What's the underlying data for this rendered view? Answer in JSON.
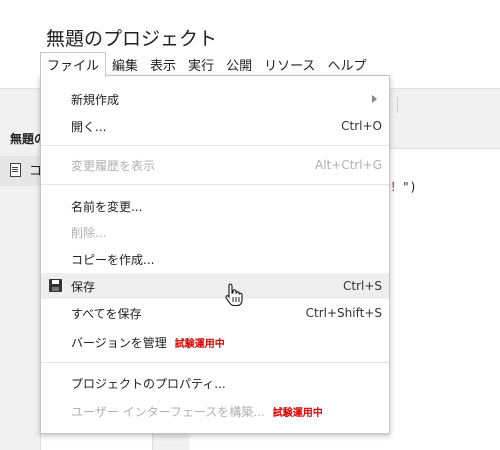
{
  "window": {
    "title": "無題のプロジェクト"
  },
  "menubar": {
    "items": [
      "ファイル",
      "編集",
      "表示",
      "実行",
      "公開",
      "リソース",
      "ヘルプ"
    ]
  },
  "sidebar": {
    "title": "無題の",
    "file": "コ"
  },
  "editor": {
    "fragment_text": "d！",
    "fragment_close": "\")"
  },
  "file_menu": {
    "new": {
      "label": "新規作成"
    },
    "open": {
      "label": "開く...",
      "shortcut": "Ctrl+O"
    },
    "history": {
      "label": "変更履歴を表示",
      "shortcut": "Alt+Ctrl+G"
    },
    "rename": {
      "label": "名前を変更..."
    },
    "delete": {
      "label": "削除..."
    },
    "copy": {
      "label": "コピーを作成..."
    },
    "save": {
      "label": "保存",
      "shortcut": "Ctrl+S"
    },
    "save_all": {
      "label": "すべてを保存",
      "shortcut": "Ctrl+Shift+S"
    },
    "versions": {
      "label": "バージョンを管理",
      "badge": "試験運用中"
    },
    "properties": {
      "label": "プロジェクトのプロパティ..."
    },
    "ui_builder": {
      "label": "ユーザー インターフェースを構築...",
      "badge": "試験運用中"
    }
  },
  "colors": {
    "badge": "#dd0000",
    "highlight": "#eeeeee",
    "disabled": "#b0b0b0"
  },
  "icons": {
    "save": "floppy-disk-icon",
    "submenu": "chevron-right-icon",
    "cursor": "hand-pointer-icon",
    "file": "document-icon"
  }
}
